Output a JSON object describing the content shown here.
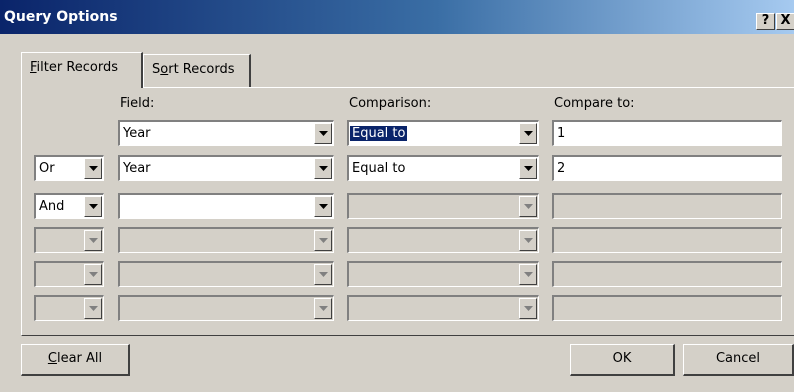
{
  "window": {
    "title": "Query Options",
    "help_label": "?",
    "close_label": "X"
  },
  "tabs": [
    {
      "label_pre": "",
      "label_key": "F",
      "label_post": "ilter Records"
    },
    {
      "label_pre": "S",
      "label_key": "o",
      "label_post": "rt Records"
    }
  ],
  "columns": {
    "field": "Field:",
    "comparison": "Comparison:",
    "compare_to": "Compare to:"
  },
  "rows": [
    {
      "connector": "",
      "field": "Year",
      "comparison": "Equal to",
      "compare_to": "1"
    },
    {
      "connector": "Or",
      "field": "Year",
      "comparison": "Equal to",
      "compare_to": "2"
    },
    {
      "connector": "And",
      "field": "",
      "comparison": "",
      "compare_to": ""
    },
    {
      "connector": "",
      "field": "",
      "comparison": "",
      "compare_to": ""
    },
    {
      "connector": "",
      "field": "",
      "comparison": "",
      "compare_to": ""
    },
    {
      "connector": "",
      "field": "",
      "comparison": "",
      "compare_to": ""
    }
  ],
  "buttons": {
    "clear_key": "C",
    "clear_rest": "lear All",
    "ok": "OK",
    "cancel": "Cancel"
  }
}
